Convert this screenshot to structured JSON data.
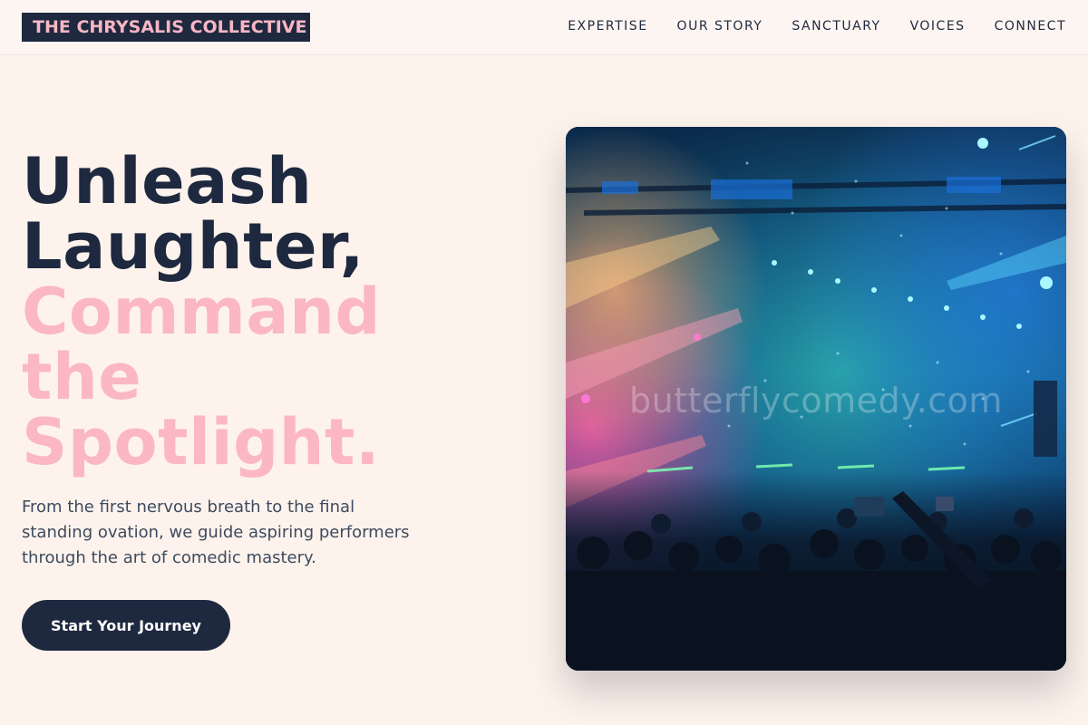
{
  "brand": {
    "name": "THE CHRYSALIS COLLECTIVE",
    "colors": {
      "navy": "#1e2940",
      "pink": "#fbb7c3",
      "background": "#fdf3ec"
    }
  },
  "nav": {
    "items": [
      {
        "label": "EXPERTISE"
      },
      {
        "label": "OUR STORY"
      },
      {
        "label": "SANCTUARY"
      },
      {
        "label": "VOICES"
      },
      {
        "label": "CONNECT"
      }
    ]
  },
  "hero": {
    "title_line1": "Unleash",
    "title_line2": "Laughter,",
    "accent_line1": "Command",
    "accent_line2": "the",
    "accent_line3": "Spotlight.",
    "description": "From the first nervous breath to the final standing ovation, we guide aspiring performers through the art of comedic mastery.",
    "cta_label": "Start Your Journey",
    "image_watermark": "butterflycomedy.com"
  }
}
